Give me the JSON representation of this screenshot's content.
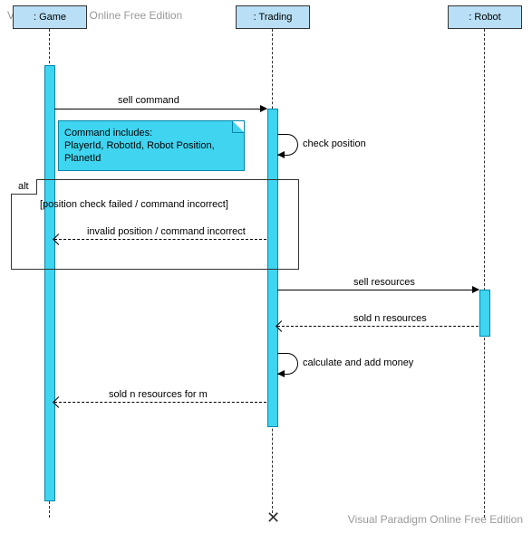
{
  "participants": {
    "game": ": Game",
    "trading": ": Trading",
    "robot": ": Robot"
  },
  "messages": {
    "sell_command": "sell command",
    "check_position": "check position",
    "invalid": "invalid position / command incorrect",
    "sell_resources": "sell resources",
    "sold_n": "sold n resources",
    "calc_money": "calculate and add money",
    "sold_for_m": "sold n resources for m"
  },
  "note": {
    "line1": "Command includes:",
    "line2": "PlayerId, RobotId, Robot Position,",
    "line3": "PlanetId"
  },
  "alt": {
    "tag": "alt",
    "guard": "[position check failed / command incorrect]"
  },
  "watermark": "Visual Paradigm Online Free Edition"
}
